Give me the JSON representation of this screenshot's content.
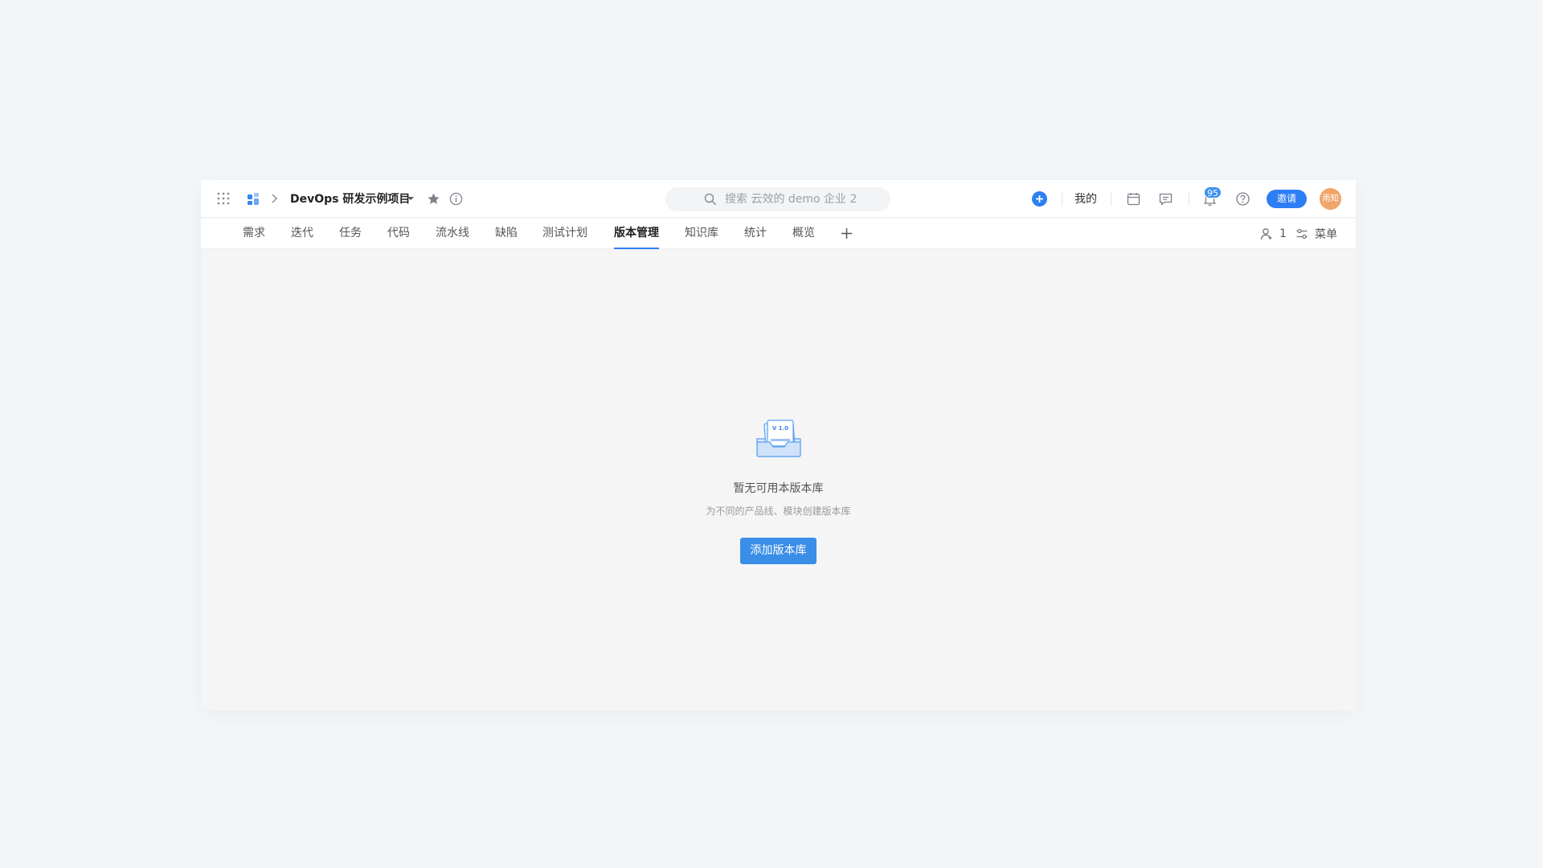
{
  "header": {
    "project_name": "DevOps 研发示例项目",
    "search_placeholder": "搜索 云效的 demo 企业 2",
    "mine_label": "我的",
    "notification_count": "95",
    "invite_label": "邀请",
    "avatar_text": "雨知"
  },
  "tabs": [
    {
      "label": "需求"
    },
    {
      "label": "迭代"
    },
    {
      "label": "任务"
    },
    {
      "label": "代码"
    },
    {
      "label": "流水线"
    },
    {
      "label": "缺陷"
    },
    {
      "label": "测试计划"
    },
    {
      "label": "版本管理",
      "active": true
    },
    {
      "label": "知识库"
    },
    {
      "label": "统计"
    },
    {
      "label": "概览"
    }
  ],
  "tabbar_right": {
    "members_count": "1",
    "menu_label": "菜单"
  },
  "empty_state": {
    "illustration_text": "V 1.0",
    "title": "暂无可用本版本库",
    "subtitle": "为不同的产品线、模块创建版本库",
    "button_label": "添加版本库"
  },
  "colors": {
    "accent": "#2f7ff0",
    "button": "#3a8ee8",
    "avatar": "#f0a56a",
    "page_bg": "#f2f6f9"
  }
}
